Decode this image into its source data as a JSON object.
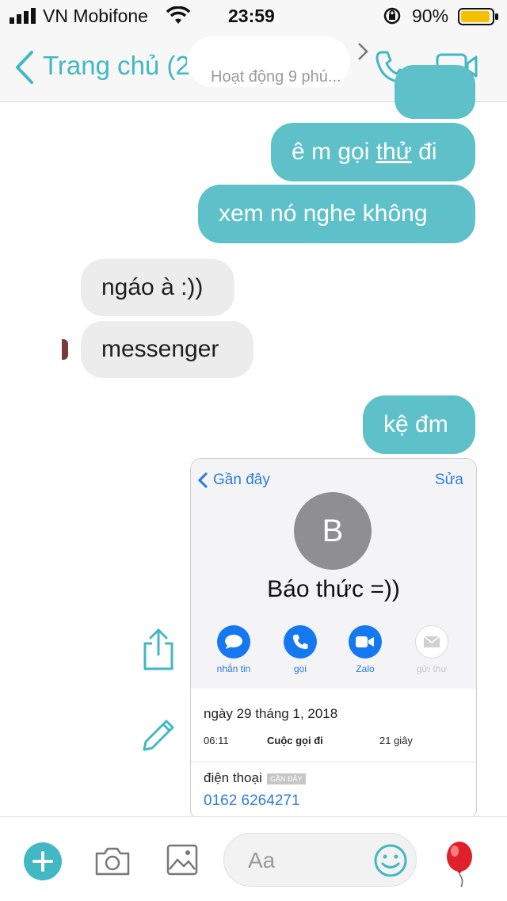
{
  "status_bar": {
    "carrier": "VN Mobifone",
    "time": "23:59",
    "battery": "90%"
  },
  "nav": {
    "back_label": "Trang chủ (2",
    "subtitle": "Hoạt động 9 phú..."
  },
  "messages": [
    {
      "dir": "out",
      "text": ""
    },
    {
      "dir": "out",
      "text_pre": "ê m gọi ",
      "text_link": "thử",
      "text_post": " đi"
    },
    {
      "dir": "out",
      "text": "xem nó nghe không"
    },
    {
      "dir": "in",
      "text": "ngáo à :))"
    },
    {
      "dir": "in",
      "text": "messenger"
    },
    {
      "dir": "out",
      "text": "kệ đm"
    }
  ],
  "shared_image": {
    "back": "Gần đây",
    "edit": "Sửa",
    "avatar_letter": "B",
    "contact_name": "Báo thức =))",
    "actions": [
      "nhắn tin",
      "gọi",
      "Zalo",
      "gửi thư"
    ],
    "date": "ngày 29 tháng 1, 2018",
    "call_time": "06:11",
    "call_type": "Cuộc gọi đi",
    "call_duration": "21 giây",
    "phone_label": "điện thoại",
    "phone_badge": "GẦN ĐÂY",
    "phone_number": "0162 6264271"
  },
  "composer": {
    "placeholder": "Aa"
  },
  "colors": {
    "accent": "#42b8c4",
    "bubble_out": "#5ec1c9",
    "bubble_in": "#ececec"
  }
}
